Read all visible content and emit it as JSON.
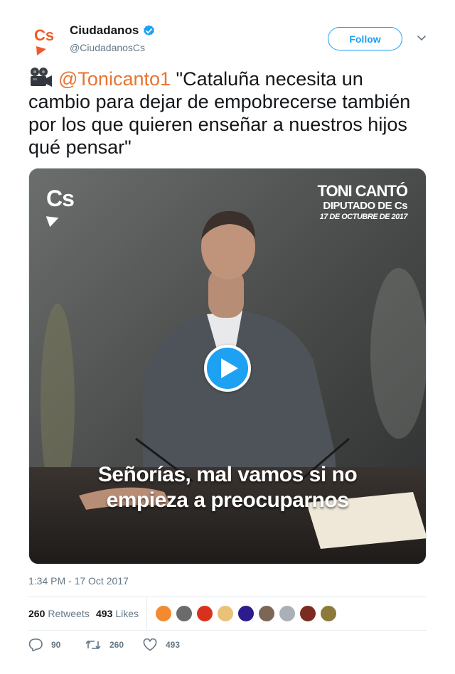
{
  "author": {
    "display_name": "Ciudadanos",
    "handle": "@CiudadanosCs",
    "verified": true,
    "avatar_text": "Cs",
    "brand_color": "#f05a28"
  },
  "follow_button": {
    "label": "Follow"
  },
  "tweet": {
    "emoji": "movie-camera",
    "mention": "@Tonicanto1",
    "text": " \"Cataluña necesita un cambio para dejar de empobrecerse también por los que quieren enseñar a nuestros hijos qué pensar\""
  },
  "media": {
    "logo_text": "Cs",
    "caption_line1": "TONI CANTÓ",
    "caption_line2": "DIPUTADO DE Cs",
    "caption_line3": "17 DE OCTUBRE DE 2017",
    "subtitle_line1": "Señorías, mal vamos si no",
    "subtitle_line2": "empieza a preocuparnos"
  },
  "timestamp": "1:34 PM - 17 Oct 2017",
  "stats": {
    "retweets_count": "260",
    "retweets_label": "Retweets",
    "likes_count": "493",
    "likes_label": "Likes"
  },
  "likers": [
    "#f28a32",
    "#6b6b6b",
    "#d8321e",
    "#e9c27a",
    "#2a1c8c",
    "#7c6656",
    "#aab0b8",
    "#7a2c20",
    "#8c7a3a"
  ],
  "actions": {
    "replies": "90",
    "retweets": "260",
    "likes": "493"
  },
  "colors": {
    "accent": "#1da1f2",
    "mention": "#e87432",
    "secondary_text": "#657786"
  }
}
